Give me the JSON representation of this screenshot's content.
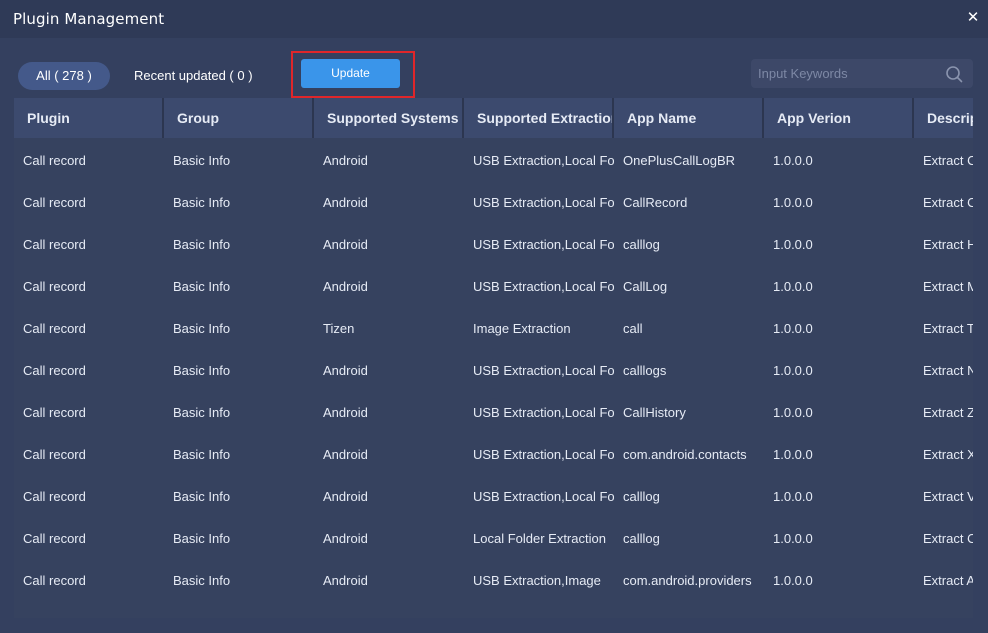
{
  "window": {
    "title": "Plugin Management",
    "close_label": "✕"
  },
  "toolbar": {
    "tab_all_label": "All ( 278 )",
    "tab_recent_label": "Recent updated ( 0 )",
    "update_label": "Update",
    "search_placeholder": "Input Keywords"
  },
  "table": {
    "columns": [
      "Plugin",
      "Group",
      "Supported Systems",
      "Supported Extraction",
      "App Name",
      "App Verion",
      "Description"
    ],
    "rows": [
      [
        "Call record",
        "Basic Info",
        "Android",
        "USB Extraction,Local Folder",
        "OnePlusCallLogBR",
        "1.0.0.0",
        "Extract Call"
      ],
      [
        "Call record",
        "Basic Info",
        "Android",
        "USB Extraction,Local Folder",
        "CallRecord",
        "1.0.0.0",
        "Extract Call"
      ],
      [
        "Call record",
        "Basic Info",
        "Android",
        "USB Extraction,Local Folder",
        "calllog",
        "1.0.0.0",
        "Extract Huawei"
      ],
      [
        "Call record",
        "Basic Info",
        "Android",
        "USB Extraction,Local Folder",
        "CallLog",
        "1.0.0.0",
        "Extract Meizu"
      ],
      [
        "Call record",
        "Basic Info",
        "Tizen",
        "Image Extraction",
        "call",
        "1.0.0.0",
        "Extract Tizen"
      ],
      [
        "Call record",
        "Basic Info",
        "Android",
        "USB Extraction,Local Folder",
        "calllogs",
        "1.0.0.0",
        "Extract Nokia"
      ],
      [
        "Call record",
        "Basic Info",
        "Android",
        "USB Extraction,Local Folder",
        "CallHistory",
        "1.0.0.0",
        "Extract ZTE"
      ],
      [
        "Call record",
        "Basic Info",
        "Android",
        "USB Extraction,Local Folder",
        "com.android.contacts",
        "1.0.0.0",
        "Extract Xiaomi"
      ],
      [
        "Call record",
        "Basic Info",
        "Android",
        "USB Extraction,Local Folder",
        "calllog",
        "1.0.0.0",
        "Extract Vivo"
      ],
      [
        "Call record",
        "Basic Info",
        "Android",
        "Local Folder Extraction",
        "calllog",
        "1.0.0.0",
        "Extract Oppo"
      ],
      [
        "Call record",
        "Basic Info",
        "Android",
        "USB Extraction,Image",
        "com.android.providers",
        "1.0.0.0",
        "Extract Android"
      ]
    ]
  },
  "colors": {
    "background": "#34405f",
    "header_cell": "#3c4a6e",
    "accent_button": "#3a95ea",
    "highlight_border": "#e0262a"
  },
  "icons": {
    "search": "search-icon",
    "close": "close-icon"
  }
}
